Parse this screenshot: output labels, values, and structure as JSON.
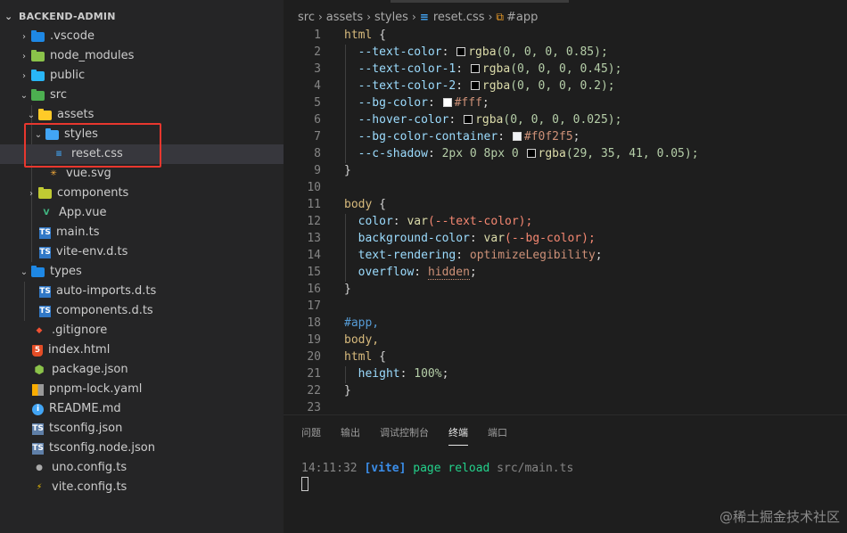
{
  "sidebar": {
    "title": "BACKEND-ADMIN",
    "items": [
      {
        "label": ".vscode",
        "icon": "vscode-folder-icon"
      },
      {
        "label": "node_modules",
        "icon": "node-folder-icon"
      },
      {
        "label": "public",
        "icon": "public-folder-icon"
      },
      {
        "label": "src",
        "icon": "src-folder-icon"
      },
      {
        "label": "assets",
        "icon": "assets-folder-icon"
      },
      {
        "label": "styles",
        "icon": "styles-folder-icon"
      },
      {
        "label": "reset.css",
        "icon": "css-file-icon"
      },
      {
        "label": "vue.svg",
        "icon": "svg-file-icon"
      },
      {
        "label": "components",
        "icon": "components-folder-icon"
      },
      {
        "label": "App.vue",
        "icon": "vue-file-icon"
      },
      {
        "label": "main.ts",
        "icon": "ts-file-icon"
      },
      {
        "label": "vite-env.d.ts",
        "icon": "ts-file-icon"
      },
      {
        "label": "types",
        "icon": "types-folder-icon"
      },
      {
        "label": "auto-imports.d.ts",
        "icon": "ts-file-icon"
      },
      {
        "label": "components.d.ts",
        "icon": "ts-file-icon"
      },
      {
        "label": ".gitignore",
        "icon": "git-icon"
      },
      {
        "label": "index.html",
        "icon": "html-file-icon"
      },
      {
        "label": "package.json",
        "icon": "node-json-icon"
      },
      {
        "label": "pnpm-lock.yaml",
        "icon": "yaml-file-icon"
      },
      {
        "label": "README.md",
        "icon": "readme-icon"
      },
      {
        "label": "tsconfig.json",
        "icon": "tsconfig-icon"
      },
      {
        "label": "tsconfig.node.json",
        "icon": "tsconfig-icon"
      },
      {
        "label": "uno.config.ts",
        "icon": "uno-config-icon"
      },
      {
        "label": "vite.config.ts",
        "icon": "vite-config-icon"
      }
    ]
  },
  "breadcrumb": {
    "parts": [
      "src",
      "assets",
      "styles",
      "reset.css",
      "#app"
    ]
  },
  "code": {
    "line_numbers": [
      "1",
      "2",
      "3",
      "4",
      "5",
      "6",
      "7",
      "8",
      "9",
      "10",
      "11",
      "12",
      "13",
      "14",
      "15",
      "16",
      "17",
      "18",
      "19",
      "20",
      "21",
      "22",
      "23"
    ],
    "l1_sel": "html",
    "l1_brace": " {",
    "l2_prop": "--text-color",
    "l2_fn": "rgba",
    "l2_args": "(0, 0, 0, 0.85);",
    "l3_prop": "--text-color-1",
    "l3_fn": "rgba",
    "l3_args": "(0, 0, 0, 0.45);",
    "l4_prop": "--text-color-2",
    "l4_fn": "rgba",
    "l4_args": "(0, 0, 0, 0.2);",
    "l5_prop": "--bg-color",
    "l5_val": "#fff",
    "l6_prop": "--hover-color",
    "l6_fn": "rgba",
    "l6_args": "(0, 0, 0, 0.025);",
    "l7_prop": "--bg-color-container",
    "l7_val": "#f0f2f5",
    "l8_prop": "--c-shadow",
    "l8_pre": "2px 0 8px 0",
    "l8_fn": "rgba",
    "l8_args": "(29, 35, 41, 0.05);",
    "l9": "}",
    "l11_sel": "body",
    "l11_brace": " {",
    "l12_prop": "color",
    "l12_fn": "var",
    "l12_args": "(--text-color);",
    "l13_prop": "background-color",
    "l13_fn": "var",
    "l13_args": "(--bg-color);",
    "l14_prop": "text-rendering",
    "l14_val": "optimizeLegibility",
    "l15_prop": "overflow",
    "l15_val": "hidden",
    "l16": "}",
    "l18": "#app,",
    "l19": "body,",
    "l20_sel": "html",
    "l20_brace": " {",
    "l21_prop": "height",
    "l21_val": "100%",
    "l22": "}"
  },
  "panel": {
    "tabs": [
      "问题",
      "输出",
      "调试控制台",
      "终端",
      "端口"
    ],
    "active_tab": "终端",
    "terminal": {
      "time": "14:11:32",
      "tag": "[vite]",
      "message": "page reload",
      "path": "src/main.ts"
    }
  },
  "watermark": "@稀土掘金技术社区",
  "colors": {
    "sidebar_bg": "#252526",
    "editor_bg": "#1e1e1e",
    "highlight_box": "#e8372e",
    "swatch_white": "#ffffff",
    "swatch_f0f2f5": "#f0f2f5"
  }
}
